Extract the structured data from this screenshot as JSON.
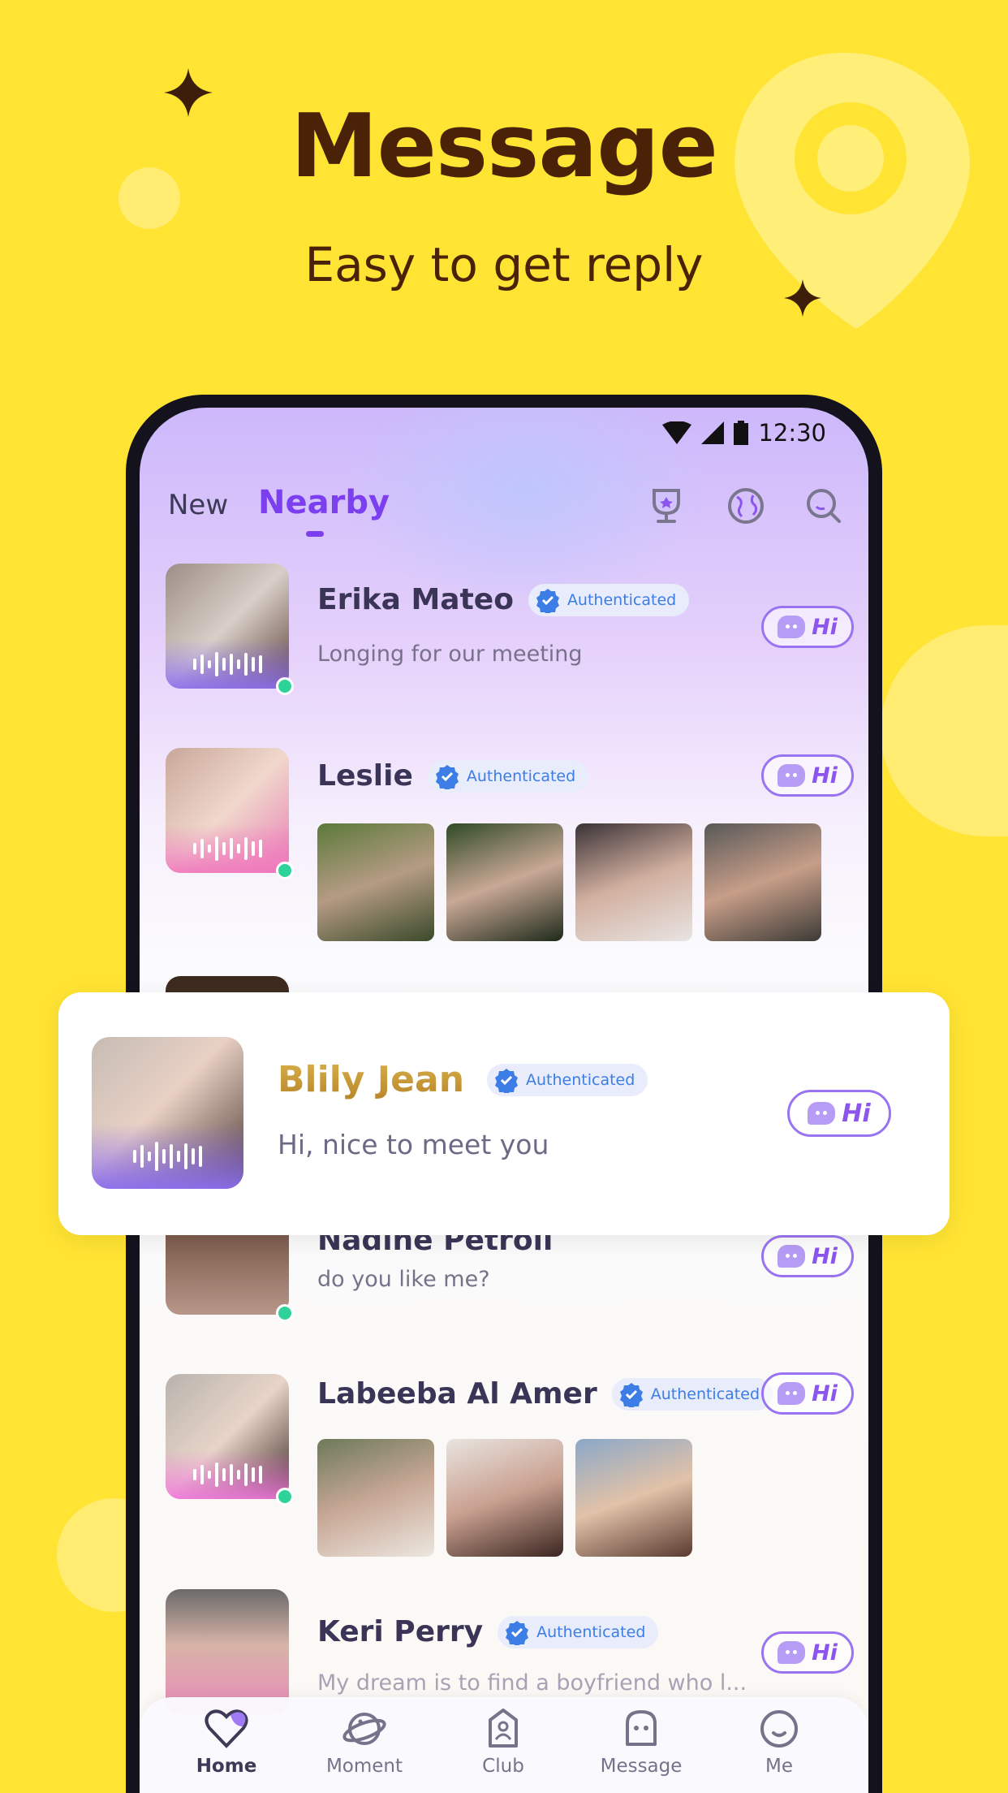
{
  "hero": {
    "title": "Message",
    "subtitle": "Easy to get reply"
  },
  "colors": {
    "background": "#FFE433",
    "accent": "#7b3ff0",
    "title": "#4A2208",
    "online": "#2ed39a",
    "verified": "#3c7de6",
    "gold": "#c99a2e"
  },
  "status": {
    "time": "12:30"
  },
  "tabs": [
    {
      "label": "New",
      "active": false
    },
    {
      "label": "Nearby",
      "active": true
    }
  ],
  "header_icons": [
    "trophy-icon",
    "globe-icon",
    "search-icon"
  ],
  "badge_label": "Authenticated",
  "hi_label": "Hi",
  "users": [
    {
      "name": "Erika Mateo",
      "message": "Longing for our meeting",
      "online": true,
      "voice": true
    },
    {
      "name": "Leslie",
      "online": true,
      "voice": true,
      "photos": 4
    },
    {
      "name": "Nadine Petroli",
      "message": "do you like me?",
      "online": true
    },
    {
      "name": "Labeeba Al Amer",
      "online": true,
      "voice": true,
      "photos": 3
    },
    {
      "name": "Keri Perry",
      "message": "My dream is to find a boyfriend who l..."
    }
  ],
  "featured": {
    "name": "Blily Jean",
    "message": "Hi, nice to meet you"
  },
  "nav": [
    {
      "label": "Home",
      "icon": "heart-icon",
      "active": true
    },
    {
      "label": "Moment",
      "icon": "planet-icon"
    },
    {
      "label": "Club",
      "icon": "club-icon"
    },
    {
      "label": "Message",
      "icon": "chat-icon"
    },
    {
      "label": "Me",
      "icon": "smile-icon"
    }
  ]
}
